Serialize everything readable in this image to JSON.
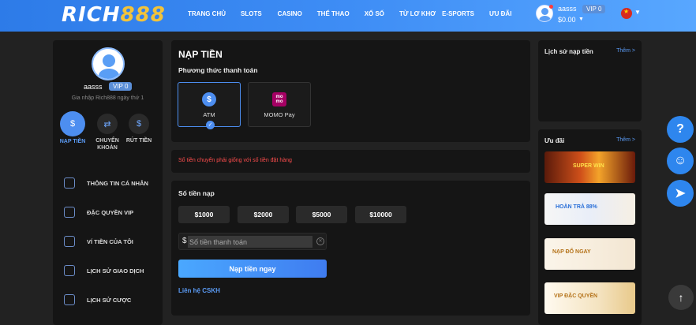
{
  "header": {
    "logo_text": "RICH",
    "logo_num": "888",
    "nav": [
      "TRANG CHỦ",
      "SLOTS",
      "CASINO",
      "THỂ THAO",
      "XỔ SỐ",
      "TỪ LƠ KHƠ",
      "E-SPORTS",
      "ƯU ĐÃI"
    ],
    "username": "aasss",
    "vip": "VIP 0",
    "balance": "$0.00"
  },
  "sidebar": {
    "username": "aasss",
    "vip": "VIP 0",
    "joined": "Gia nhập Rich888 ngày thứ 1",
    "quick_actions": [
      {
        "label": "NẠP TIỀN",
        "icon": "deposit-icon"
      },
      {
        "label": "CHUYỂN KHOẢN",
        "icon": "transfer-icon"
      },
      {
        "label": "RÚT TIỀN",
        "icon": "withdraw-icon"
      }
    ],
    "menu": [
      {
        "label": "THÔNG TIN CÁ NHÂN",
        "icon": "user-icon"
      },
      {
        "label": "ĐẶC QUYỀN VIP",
        "icon": "star-icon"
      },
      {
        "label": "VÍ TIỀN CỦA TÔI",
        "icon": "wallet-icon"
      },
      {
        "label": "LỊCH SỬ GIAO DỊCH",
        "icon": "history-icon"
      },
      {
        "label": "LỊCH SỬ CƯỢC",
        "icon": "bet-history-icon"
      }
    ]
  },
  "deposit": {
    "title": "NẠP TIỀN",
    "method_label": "Phương thức thanh toán",
    "methods": [
      {
        "label": "ATM",
        "icon": "dollar-icon",
        "selected": true
      },
      {
        "label": "MOMO Pay",
        "icon": "momo-icon",
        "selected": false
      }
    ],
    "momo_logo": "mo mo",
    "warning": "Số tiền chuyển phải giống với số tiền đặt hàng",
    "amount_label": "Số tiền nạp",
    "amounts": [
      "$1000",
      "$2000",
      "$5000",
      "$10000"
    ],
    "currency_symbol": "$",
    "amount_placeholder": "Số tiền thanh toán",
    "submit": "Nạp tiền ngay",
    "contact": "Liên hệ CSKH"
  },
  "right": {
    "history_title": "Lịch sử nạp tiền",
    "history_more": "Thêm >",
    "promo_title": "Ưu đãi",
    "promo_more": "Thêm >",
    "promos": [
      {
        "text": "SUPER WIN"
      },
      {
        "text": "HOÀN TRẢ 88%"
      },
      {
        "text": "NẠP ĐỔ NGAY"
      },
      {
        "text": "VIP ĐẶC QUYỀN"
      }
    ]
  },
  "colors": {
    "accent": "#4d8ef0",
    "header_from": "#2d7be8",
    "header_to": "#58a7ff",
    "warning": "#ff4d4d",
    "panel_bg": "#151515",
    "page_bg": "#222222"
  }
}
